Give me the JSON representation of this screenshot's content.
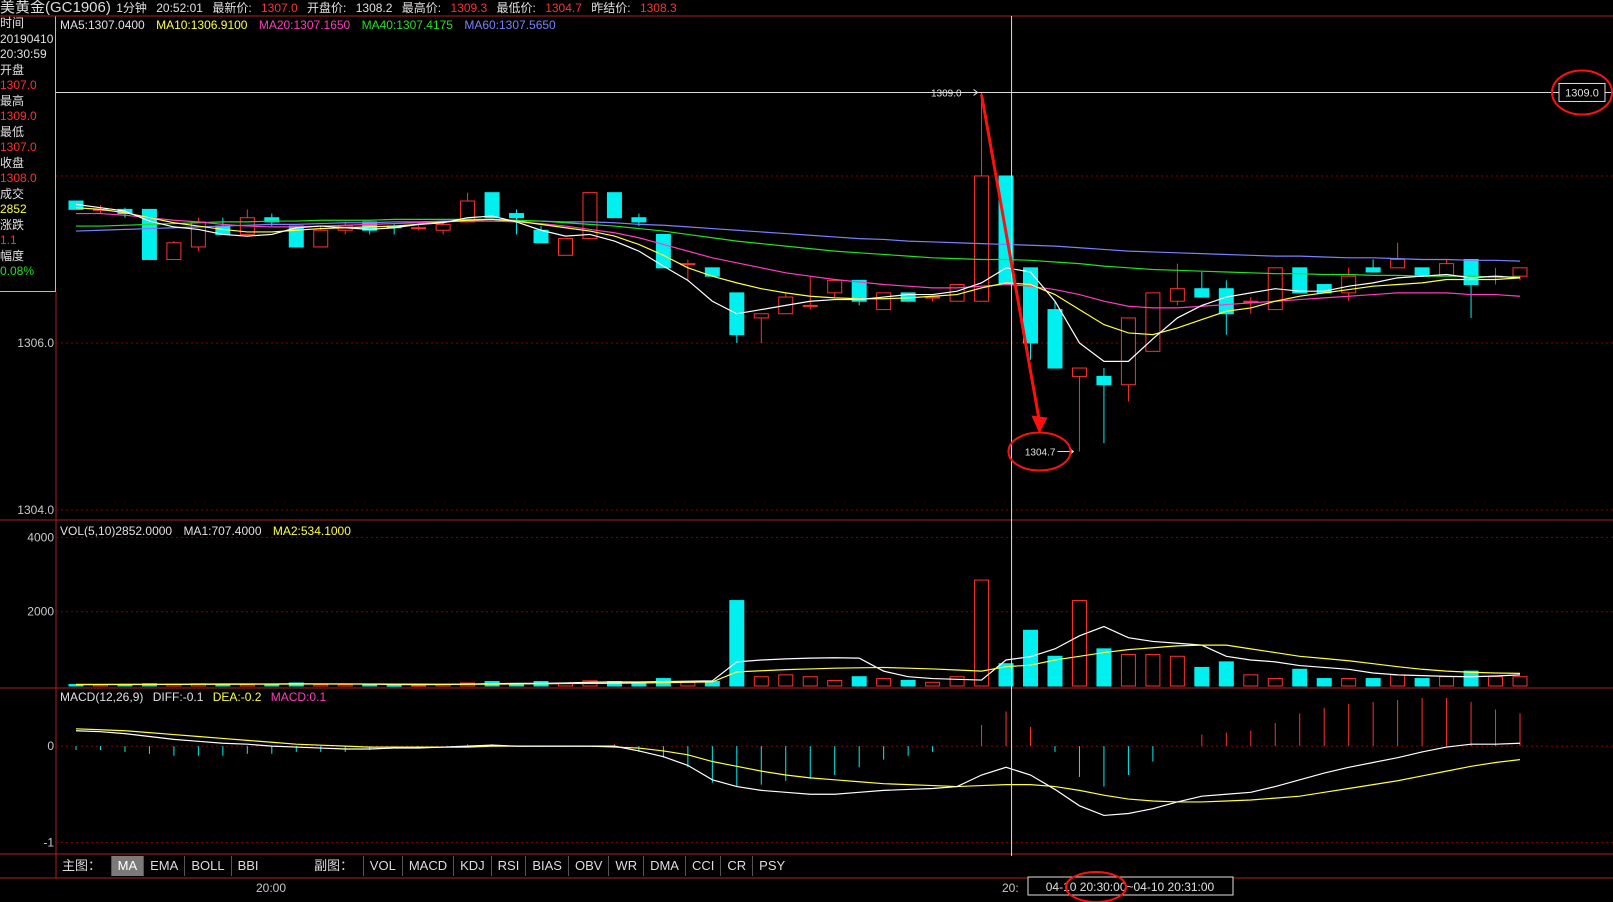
{
  "header": {
    "title": "美黄金(GC1906)",
    "period": "1分钟",
    "time": "20:52:01",
    "latest_label": "最新价:",
    "latest": "1307.0",
    "open_label": "开盘价:",
    "open": "1308.2",
    "high_label": "最高价:",
    "high": "1309.3",
    "low_label": "最低价:",
    "low": "1304.7",
    "prev_label": "昨结价:",
    "prev": "1308.3"
  },
  "info": {
    "time_label": "时间",
    "date": "20190410",
    "clock": "20:30:59",
    "open_label": "开盘",
    "open": "1307.0",
    "high_label": "最高",
    "high": "1309.0",
    "low_label": "最低",
    "low": "1307.0",
    "close_label": "收盘",
    "close": "1308.0",
    "vol_label": "成交",
    "vol": "2852",
    "chg_label": "涨跌",
    "chg": "1.1",
    "pct_label": "幅度",
    "pct": "0.08%"
  },
  "ma_legend": {
    "ma5": "MA5:1307.0400",
    "ma10": "MA10:1306.9100",
    "ma20": "MA20:1307.1650",
    "ma40": "MA40:1307.4175",
    "ma60": "MA60:1307.5650"
  },
  "vol_legend": {
    "vol": "VOL(5,10)2852.0000",
    "ma1": "MA1:707.4000",
    "ma2": "MA2:534.1000"
  },
  "macd_legend": {
    "name": "MACD(12,26,9)",
    "diff": "DIFF:-0.1",
    "dea": "DEA:-0.2",
    "macd": "MACD:0.1"
  },
  "toolbar": {
    "main_label": "主图：",
    "main_items": [
      "MA",
      "EMA",
      "BOLL",
      "BBI"
    ],
    "sub_label": "副图：",
    "sub_items": [
      "VOL",
      "MACD",
      "KDJ",
      "RSI",
      "BIAS",
      "OBV",
      "WR",
      "DMA",
      "CCI",
      "CR",
      "PSY"
    ]
  },
  "timeaxis": {
    "tick_left": "20:00",
    "tick_mid": "20:",
    "cursor_label": "04-10 20:30:00~04-10 20:31:00"
  },
  "colors": {
    "up": "#ff3030",
    "down": "#00f0f0",
    "ma5": "#ffffff",
    "ma10": "#ffff3c",
    "ma20": "#ff3cbe",
    "ma40": "#22e022",
    "ma60": "#7a80ff",
    "annotation": "#ff1010",
    "grid": "#8a0000"
  },
  "chart_data": {
    "type": "candlestick",
    "price_axis": {
      "ticks": [
        "1306.0",
        "1304.0"
      ],
      "ylim": [
        1304.0,
        1309.7
      ]
    },
    "volume_axis": {
      "ticks": [
        "4000",
        "2000"
      ],
      "ylim": [
        0,
        4200
      ]
    },
    "macd_axis": {
      "ticks": [
        "0",
        "-1"
      ],
      "ylim": [
        -1.1,
        0.5
      ]
    },
    "annotations": {
      "high_marker": "1309.0",
      "low_marker": "1304.7",
      "cursor_price": "1309.0"
    },
    "candles": [
      {
        "o": 1307.7,
        "h": 1307.7,
        "l": 1307.6,
        "c": 1307.6,
        "v": 40
      },
      {
        "o": 1307.6,
        "h": 1307.65,
        "l": 1307.55,
        "c": 1307.6,
        "v": 40
      },
      {
        "o": 1307.6,
        "h": 1307.62,
        "l": 1307.5,
        "c": 1307.55,
        "v": 40
      },
      {
        "o": 1307.6,
        "h": 1307.6,
        "l": 1307.0,
        "c": 1307.0,
        "v": 60
      },
      {
        "o": 1307.0,
        "h": 1307.22,
        "l": 1307.0,
        "c": 1307.2,
        "v": 40
      },
      {
        "o": 1307.15,
        "h": 1307.5,
        "l": 1307.1,
        "c": 1307.45,
        "v": 60
      },
      {
        "o": 1307.4,
        "h": 1307.5,
        "l": 1307.3,
        "c": 1307.3,
        "v": 40
      },
      {
        "o": 1307.3,
        "h": 1307.6,
        "l": 1307.3,
        "c": 1307.5,
        "v": 40
      },
      {
        "o": 1307.5,
        "h": 1307.55,
        "l": 1307.4,
        "c": 1307.45,
        "v": 40
      },
      {
        "o": 1307.4,
        "h": 1307.4,
        "l": 1307.15,
        "c": 1307.15,
        "v": 80
      },
      {
        "o": 1307.15,
        "h": 1307.4,
        "l": 1307.15,
        "c": 1307.35,
        "v": 40
      },
      {
        "o": 1307.35,
        "h": 1307.45,
        "l": 1307.3,
        "c": 1307.4,
        "v": 40
      },
      {
        "o": 1307.45,
        "h": 1307.45,
        "l": 1307.3,
        "c": 1307.35,
        "v": 40
      },
      {
        "o": 1307.4,
        "h": 1307.42,
        "l": 1307.3,
        "c": 1307.38,
        "v": 20
      },
      {
        "o": 1307.38,
        "h": 1307.42,
        "l": 1307.35,
        "c": 1307.38,
        "v": 20
      },
      {
        "o": 1307.35,
        "h": 1307.45,
        "l": 1307.3,
        "c": 1307.42,
        "v": 40
      },
      {
        "o": 1307.45,
        "h": 1307.8,
        "l": 1307.45,
        "c": 1307.7,
        "v": 80
      },
      {
        "o": 1307.8,
        "h": 1307.8,
        "l": 1307.5,
        "c": 1307.5,
        "v": 120
      },
      {
        "o": 1307.55,
        "h": 1307.6,
        "l": 1307.3,
        "c": 1307.5,
        "v": 40
      },
      {
        "o": 1307.35,
        "h": 1307.4,
        "l": 1307.2,
        "c": 1307.2,
        "v": 120
      },
      {
        "o": 1307.05,
        "h": 1307.25,
        "l": 1307.05,
        "c": 1307.25,
        "v": 80
      },
      {
        "o": 1307.25,
        "h": 1307.8,
        "l": 1307.25,
        "c": 1307.8,
        "v": 140
      },
      {
        "o": 1307.8,
        "h": 1307.8,
        "l": 1307.5,
        "c": 1307.5,
        "v": 120
      },
      {
        "o": 1307.5,
        "h": 1307.55,
        "l": 1307.4,
        "c": 1307.45,
        "v": 80
      },
      {
        "o": 1307.3,
        "h": 1307.3,
        "l": 1306.9,
        "c": 1306.9,
        "v": 200
      },
      {
        "o": 1306.95,
        "h": 1307.0,
        "l": 1306.75,
        "c": 1306.95,
        "v": 100
      },
      {
        "o": 1306.9,
        "h": 1306.9,
        "l": 1306.8,
        "c": 1306.8,
        "v": 120
      },
      {
        "o": 1306.6,
        "h": 1306.6,
        "l": 1306.0,
        "c": 1306.1,
        "v": 2300
      },
      {
        "o": 1306.3,
        "h": 1306.35,
        "l": 1306.0,
        "c": 1306.35,
        "v": 250
      },
      {
        "o": 1306.35,
        "h": 1306.6,
        "l": 1306.35,
        "c": 1306.55,
        "v": 300
      },
      {
        "o": 1306.45,
        "h": 1306.8,
        "l": 1306.4,
        "c": 1306.45,
        "v": 250
      },
      {
        "o": 1306.6,
        "h": 1306.75,
        "l": 1306.55,
        "c": 1306.75,
        "v": 150
      },
      {
        "o": 1306.75,
        "h": 1306.75,
        "l": 1306.45,
        "c": 1306.5,
        "v": 250
      },
      {
        "o": 1306.4,
        "h": 1306.6,
        "l": 1306.4,
        "c": 1306.6,
        "v": 200
      },
      {
        "o": 1306.6,
        "h": 1306.6,
        "l": 1306.5,
        "c": 1306.5,
        "v": 150
      },
      {
        "o": 1306.55,
        "h": 1306.55,
        "l": 1306.5,
        "c": 1306.55,
        "v": 100
      },
      {
        "o": 1306.5,
        "h": 1306.7,
        "l": 1306.5,
        "c": 1306.7,
        "v": 250
      },
      {
        "o": 1306.5,
        "h": 1309.0,
        "l": 1306.5,
        "c": 1308.0,
        "v": 2852
      },
      {
        "o": 1308.0,
        "h": 1308.0,
        "l": 1306.7,
        "c": 1306.7,
        "v": 600
      },
      {
        "o": 1306.9,
        "h": 1306.9,
        "l": 1305.8,
        "c": 1306.0,
        "v": 1500
      },
      {
        "o": 1306.4,
        "h": 1306.5,
        "l": 1305.7,
        "c": 1305.7,
        "v": 800
      },
      {
        "o": 1305.6,
        "h": 1305.7,
        "l": 1304.7,
        "c": 1305.7,
        "v": 2300
      },
      {
        "o": 1305.6,
        "h": 1305.7,
        "l": 1304.8,
        "c": 1305.5,
        "v": 1000
      },
      {
        "o": 1305.5,
        "h": 1306.3,
        "l": 1305.3,
        "c": 1306.3,
        "v": 850
      },
      {
        "o": 1305.9,
        "h": 1306.6,
        "l": 1305.9,
        "c": 1306.6,
        "v": 850
      },
      {
        "o": 1306.5,
        "h": 1306.95,
        "l": 1306.45,
        "c": 1306.65,
        "v": 800
      },
      {
        "o": 1306.65,
        "h": 1306.85,
        "l": 1306.55,
        "c": 1306.55,
        "v": 500
      },
      {
        "o": 1306.65,
        "h": 1306.75,
        "l": 1306.1,
        "c": 1306.35,
        "v": 650
      },
      {
        "o": 1306.5,
        "h": 1306.55,
        "l": 1306.35,
        "c": 1306.5,
        "v": 300
      },
      {
        "o": 1306.4,
        "h": 1306.9,
        "l": 1306.4,
        "c": 1306.9,
        "v": 200
      },
      {
        "o": 1306.9,
        "h": 1306.9,
        "l": 1306.6,
        "c": 1306.6,
        "v": 450
      },
      {
        "o": 1306.7,
        "h": 1306.7,
        "l": 1306.6,
        "c": 1306.6,
        "v": 200
      },
      {
        "o": 1306.6,
        "h": 1306.9,
        "l": 1306.5,
        "c": 1306.8,
        "v": 200
      },
      {
        "o": 1306.9,
        "h": 1307.0,
        "l": 1306.85,
        "c": 1306.85,
        "v": 200
      },
      {
        "o": 1306.9,
        "h": 1307.2,
        "l": 1306.9,
        "c": 1307.0,
        "v": 300
      },
      {
        "o": 1306.9,
        "h": 1306.9,
        "l": 1306.8,
        "c": 1306.8,
        "v": 200
      },
      {
        "o": 1306.8,
        "h": 1307.0,
        "l": 1306.8,
        "c": 1306.95,
        "v": 250
      },
      {
        "o": 1307.0,
        "h": 1307.0,
        "l": 1306.3,
        "c": 1306.7,
        "v": 400
      },
      {
        "o": 1306.8,
        "h": 1306.9,
        "l": 1306.7,
        "c": 1306.8,
        "v": 250
      },
      {
        "o": 1306.8,
        "h": 1306.9,
        "l": 1306.75,
        "c": 1306.9,
        "v": 250
      }
    ],
    "ma5": [
      1307.66,
      1307.62,
      1307.58,
      1307.46,
      1307.39,
      1307.36,
      1307.3,
      1307.28,
      1307.3,
      1307.38,
      1307.4,
      1307.38,
      1307.36,
      1307.38,
      1307.42,
      1307.44,
      1307.5,
      1307.52,
      1307.45,
      1307.35,
      1307.28,
      1307.3,
      1307.22,
      1307.1,
      1306.92,
      1306.75,
      1306.5,
      1306.35,
      1306.4,
      1306.45,
      1306.5,
      1306.52,
      1306.52,
      1306.55,
      1306.58,
      1306.58,
      1306.62,
      1306.72,
      1306.9,
      1306.85,
      1306.5,
      1306.0,
      1305.78,
      1305.78,
      1306.05,
      1306.3,
      1306.45,
      1306.55,
      1306.6,
      1306.65,
      1306.62,
      1306.62,
      1306.68,
      1306.72,
      1306.78,
      1306.8,
      1306.82,
      1306.78,
      1306.8,
      1306.78
    ],
    "ma10": [
      1307.62,
      1307.6,
      1307.56,
      1307.5,
      1307.44,
      1307.4,
      1307.36,
      1307.33,
      1307.33,
      1307.35,
      1307.37,
      1307.38,
      1307.39,
      1307.4,
      1307.42,
      1307.45,
      1307.47,
      1307.48,
      1307.46,
      1307.42,
      1307.38,
      1307.34,
      1307.28,
      1307.18,
      1307.05,
      1306.9,
      1306.8,
      1306.72,
      1306.65,
      1306.6,
      1306.56,
      1306.54,
      1306.53,
      1306.53,
      1306.54,
      1306.56,
      1306.58,
      1306.66,
      1306.72,
      1306.7,
      1306.58,
      1306.4,
      1306.22,
      1306.12,
      1306.1,
      1306.18,
      1306.28,
      1306.38,
      1306.42,
      1306.5,
      1306.56,
      1306.6,
      1306.64,
      1306.68,
      1306.7,
      1306.72,
      1306.76,
      1306.76,
      1306.76,
      1306.78
    ],
    "ma20": [
      1307.55,
      1307.55,
      1307.53,
      1307.5,
      1307.47,
      1307.45,
      1307.42,
      1307.4,
      1307.39,
      1307.39,
      1307.4,
      1307.41,
      1307.42,
      1307.43,
      1307.44,
      1307.45,
      1307.46,
      1307.46,
      1307.45,
      1307.43,
      1307.4,
      1307.36,
      1307.32,
      1307.26,
      1307.18,
      1307.1,
      1307.02,
      1306.96,
      1306.9,
      1306.84,
      1306.8,
      1306.76,
      1306.73,
      1306.7,
      1306.68,
      1306.66,
      1306.66,
      1306.68,
      1306.7,
      1306.68,
      1306.64,
      1306.58,
      1306.5,
      1306.44,
      1306.42,
      1306.42,
      1306.44,
      1306.46,
      1306.48,
      1306.5,
      1306.52,
      1306.54,
      1306.56,
      1306.58,
      1306.6,
      1306.6,
      1306.6,
      1306.58,
      1306.58,
      1306.56
    ],
    "ma40": [
      1307.4,
      1307.4,
      1307.41,
      1307.42,
      1307.43,
      1307.44,
      1307.45,
      1307.45,
      1307.46,
      1307.46,
      1307.47,
      1307.47,
      1307.47,
      1307.48,
      1307.48,
      1307.48,
      1307.48,
      1307.48,
      1307.47,
      1307.46,
      1307.44,
      1307.42,
      1307.4,
      1307.37,
      1307.34,
      1307.3,
      1307.26,
      1307.22,
      1307.19,
      1307.16,
      1307.13,
      1307.1,
      1307.08,
      1307.06,
      1307.04,
      1307.02,
      1307.01,
      1307.0,
      1307.0,
      1306.99,
      1306.97,
      1306.95,
      1306.92,
      1306.9,
      1306.88,
      1306.87,
      1306.86,
      1306.85,
      1306.84,
      1306.83,
      1306.83,
      1306.82,
      1306.82,
      1306.81,
      1306.81,
      1306.8,
      1306.8,
      1306.8,
      1306.79,
      1306.79
    ],
    "ma60": [
      1307.34,
      1307.35,
      1307.36,
      1307.37,
      1307.38,
      1307.39,
      1307.4,
      1307.41,
      1307.42,
      1307.42,
      1307.43,
      1307.44,
      1307.44,
      1307.45,
      1307.45,
      1307.46,
      1307.46,
      1307.46,
      1307.46,
      1307.46,
      1307.45,
      1307.45,
      1307.44,
      1307.42,
      1307.41,
      1307.39,
      1307.37,
      1307.35,
      1307.33,
      1307.31,
      1307.29,
      1307.27,
      1307.25,
      1307.24,
      1307.22,
      1307.21,
      1307.2,
      1307.19,
      1307.18,
      1307.17,
      1307.16,
      1307.14,
      1307.12,
      1307.1,
      1307.09,
      1307.08,
      1307.07,
      1307.06,
      1307.05,
      1307.04,
      1307.04,
      1307.03,
      1307.02,
      1307.02,
      1307.01,
      1307.0,
      1307.0,
      1306.99,
      1306.99,
      1306.98
    ],
    "vol_ma1": [
      40,
      40,
      45,
      45,
      45,
      50,
      55,
      55,
      55,
      60,
      55,
      55,
      50,
      40,
      35,
      40,
      50,
      65,
      70,
      70,
      80,
      100,
      110,
      110,
      120,
      130,
      140,
      650,
      700,
      730,
      750,
      760,
      750,
      400,
      250,
      200,
      180,
      160,
      700,
      790,
      1000,
      1350,
      1600,
      1300,
      1200,
      1150,
      1100,
      800,
      700,
      650,
      550,
      500,
      450,
      350,
      300,
      280,
      260,
      250,
      270,
      300
    ],
    "vol_ma2": [
      40,
      40,
      40,
      42,
      44,
      45,
      46,
      48,
      50,
      52,
      53,
      54,
      55,
      52,
      50,
      48,
      48,
      50,
      55,
      60,
      65,
      70,
      75,
      80,
      90,
      100,
      110,
      380,
      410,
      440,
      460,
      480,
      490,
      500,
      480,
      460,
      430,
      400,
      520,
      560,
      700,
      800,
      900,
      980,
      1030,
      1080,
      1100,
      1100,
      1000,
      900,
      800,
      740,
      680,
      600,
      520,
      450,
      400,
      370,
      350,
      340
    ],
    "diff": [
      0.16,
      0.15,
      0.13,
      0.1,
      0.07,
      0.05,
      0.03,
      0.02,
      0.0,
      -0.01,
      -0.02,
      -0.03,
      -0.03,
      -0.02,
      -0.02,
      -0.01,
      0.0,
      0.01,
      0.0,
      0.0,
      0.0,
      0.0,
      0.0,
      -0.05,
      -0.11,
      -0.2,
      -0.35,
      -0.42,
      -0.46,
      -0.48,
      -0.5,
      -0.5,
      -0.48,
      -0.46,
      -0.45,
      -0.44,
      -0.42,
      -0.3,
      -0.22,
      -0.3,
      -0.45,
      -0.62,
      -0.72,
      -0.7,
      -0.65,
      -0.58,
      -0.52,
      -0.5,
      -0.48,
      -0.42,
      -0.35,
      -0.28,
      -0.22,
      -0.17,
      -0.12,
      -0.06,
      -0.01,
      0.02,
      0.02,
      0.03
    ],
    "dea": [
      0.18,
      0.17,
      0.16,
      0.14,
      0.12,
      0.1,
      0.08,
      0.06,
      0.04,
      0.02,
      0.01,
      0.0,
      -0.01,
      -0.01,
      -0.01,
      -0.01,
      -0.01,
      0.0,
      0.0,
      0.0,
      0.0,
      0.0,
      -0.01,
      -0.02,
      -0.05,
      -0.09,
      -0.16,
      -0.21,
      -0.26,
      -0.3,
      -0.33,
      -0.35,
      -0.37,
      -0.39,
      -0.4,
      -0.41,
      -0.42,
      -0.41,
      -0.4,
      -0.4,
      -0.42,
      -0.46,
      -0.51,
      -0.55,
      -0.57,
      -0.58,
      -0.58,
      -0.57,
      -0.56,
      -0.54,
      -0.52,
      -0.48,
      -0.44,
      -0.4,
      -0.36,
      -0.31,
      -0.26,
      -0.21,
      -0.17,
      -0.14
    ],
    "macd_bars": [
      -0.04,
      -0.04,
      -0.06,
      -0.08,
      -0.1,
      -0.1,
      -0.1,
      -0.08,
      -0.08,
      -0.06,
      -0.06,
      -0.06,
      -0.04,
      -0.02,
      -0.02,
      0.0,
      0.02,
      0.02,
      0.0,
      0.0,
      0.0,
      0.0,
      0.02,
      -0.06,
      -0.12,
      -0.22,
      -0.38,
      -0.42,
      -0.4,
      -0.36,
      -0.34,
      -0.3,
      -0.22,
      -0.14,
      -0.1,
      -0.06,
      0.0,
      0.22,
      0.36,
      0.2,
      -0.06,
      -0.32,
      -0.42,
      -0.3,
      -0.16,
      0.0,
      0.12,
      0.14,
      0.16,
      0.24,
      0.34,
      0.4,
      0.44,
      0.46,
      0.48,
      0.5,
      0.5,
      0.46,
      0.38,
      0.34
    ]
  }
}
